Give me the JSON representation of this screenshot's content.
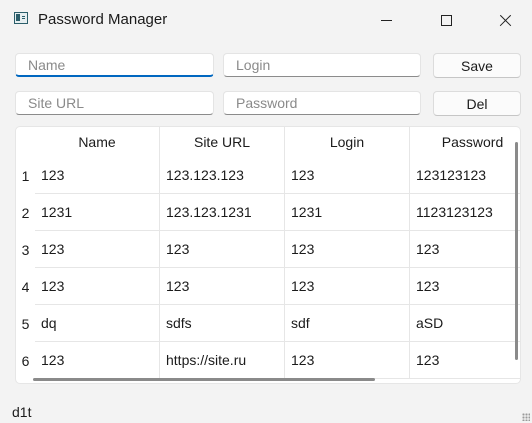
{
  "window": {
    "title": "Password Manager",
    "minimize_icon": "minimize-icon",
    "maximize_icon": "maximize-icon",
    "close_icon": "close-icon"
  },
  "form": {
    "name_placeholder": "Name",
    "login_placeholder": "Login",
    "siteurl_placeholder": "Site URL",
    "password_placeholder": "Password",
    "name_value": "",
    "login_value": "",
    "siteurl_value": "",
    "password_value": "",
    "save_label": "Save",
    "del_label": "Del"
  },
  "table": {
    "columns": [
      "Name",
      "Site URL",
      "Login",
      "Password"
    ],
    "row_headers": [
      "1",
      "2",
      "3",
      "4",
      "5",
      "6"
    ],
    "rows": [
      [
        "123",
        "123.123.123",
        "123",
        "123123123"
      ],
      [
        "1231",
        "123.123.1231",
        "1231",
        "1123123123"
      ],
      [
        "123",
        "123",
        "123",
        "123"
      ],
      [
        "123",
        "123",
        "123",
        "123"
      ],
      [
        "dq",
        "sdfs",
        "sdf",
        "aSD"
      ],
      [
        "123",
        "https://site.ru",
        "123",
        "123"
      ]
    ]
  },
  "status": {
    "text": "d1t"
  },
  "colors": {
    "accent": "#0067c0",
    "background": "#f3f3f3"
  }
}
